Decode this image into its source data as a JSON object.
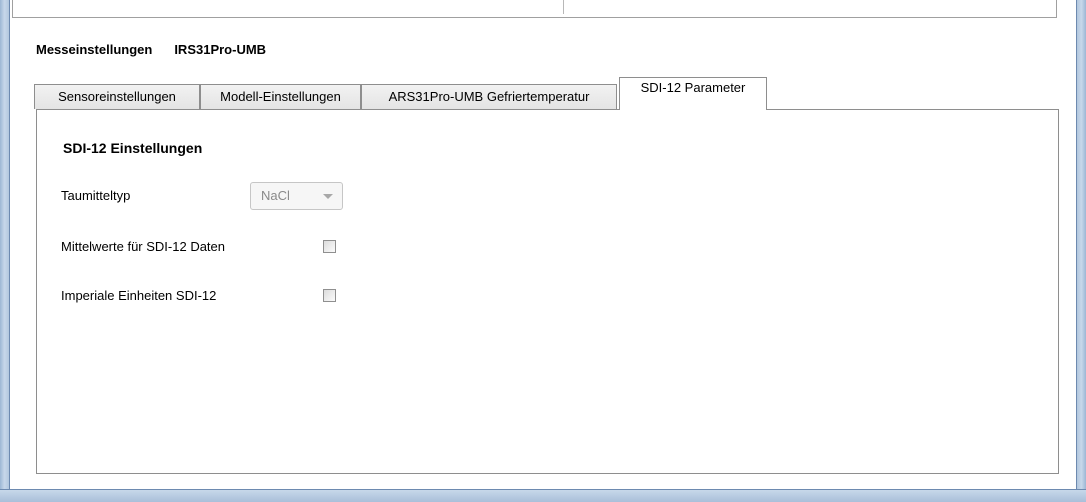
{
  "header": {
    "group_label": "Messeinstellungen",
    "device_name": "IRS31Pro-UMB"
  },
  "tabs": [
    {
      "label": "Sensoreinstellungen",
      "active": false
    },
    {
      "label": "Modell-Einstellungen",
      "active": false
    },
    {
      "label": "ARS31Pro-UMB Gefriertemperatur",
      "active": false
    },
    {
      "label": "SDI-12 Parameter",
      "active": true
    }
  ],
  "sdi12": {
    "section_title": "SDI-12 Einstellungen",
    "deicer_label": "Taumitteltyp",
    "deicer_value": "NaCl",
    "averages_label": "Mittelwerte für SDI-12 Daten",
    "averages_checked": false,
    "imperial_label": "Imperiale Einheiten SDI-12",
    "imperial_checked": false
  }
}
